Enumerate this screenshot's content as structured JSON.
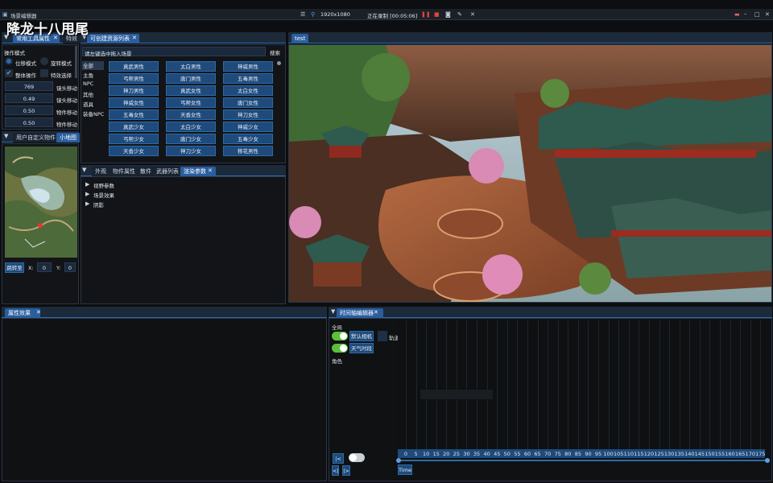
{
  "titlebar": {
    "app_title": "场景编辑器",
    "resolution": "1920x1080",
    "recording_status": "正在录制 [00:05:06]",
    "window_buttons": [
      "minimize",
      "maximize",
      "close"
    ]
  },
  "overlay_title": "降龙十八甩尾",
  "tool_panel": {
    "tabs": [
      {
        "label": "常用工具属性",
        "active": true
      },
      {
        "label": "特效",
        "active": false
      }
    ],
    "section_label": "操作模式",
    "radio_move": "位移模式",
    "radio_rotate": "旋转模式",
    "check_whole": "整体操作",
    "check_effect": "特效选择",
    "rows": [
      {
        "value": "769",
        "label": "镜头移动"
      },
      {
        "value": "0.49",
        "label": "镜头移动"
      },
      {
        "value": "0.50",
        "label": "物件移动"
      },
      {
        "value": "0.50",
        "label": "物件移动"
      }
    ]
  },
  "map_panel": {
    "tabs": [
      {
        "label": "用户自定义物件",
        "active": false
      },
      {
        "label": "小地图",
        "active": true
      }
    ],
    "jump_button": "跳转至",
    "x_label": "X:",
    "x_value": "0",
    "y_label": "Y:",
    "y_value": "0"
  },
  "resource_panel": {
    "tab": "可创建资源列表",
    "search_placeholder": "请左键选中拖入场景",
    "search_button": "搜索",
    "categories": [
      "全部",
      "主角",
      "NPC",
      "其他",
      "道具",
      "装备NPC"
    ],
    "grid": [
      [
        "真武男性",
        "太白男性",
        "神威男性"
      ],
      [
        "丐帮男性",
        "唐门男性",
        "五毒男性"
      ],
      [
        "神刀男性",
        "真武女性",
        "太白女性"
      ],
      [
        "神威女性",
        "丐帮女性",
        "唐门女性"
      ],
      [
        "五毒女性",
        "天香女性",
        "神刀女性"
      ],
      [
        "真武少女",
        "太白少女",
        "神威少女"
      ],
      [
        "丐帮少女",
        "唐门少女",
        "五毒少女"
      ],
      [
        "天香少女",
        "神刀少女",
        "移花男性"
      ]
    ]
  },
  "props_panel": {
    "tabs": [
      {
        "label": "外观",
        "active": false
      },
      {
        "label": "物件属性",
        "active": false
      },
      {
        "label": "散件",
        "active": false
      },
      {
        "label": "武器列表",
        "active": false
      },
      {
        "label": "渲染参数",
        "active": true
      }
    ],
    "tree": [
      "视野参数",
      "场景效果",
      "阴影"
    ]
  },
  "viewport": {
    "tab": "test"
  },
  "effects_panel": {
    "tab": "属性效果"
  },
  "timeline": {
    "tab": "时间轴编辑器",
    "group_all": "全局",
    "tracks": [
      {
        "label": "默认相机",
        "enabled": true,
        "extra": "轨道"
      },
      {
        "label": "天气时段",
        "enabled": true
      }
    ],
    "group_role": "角色",
    "axis_ticks": [
      "0",
      "5",
      "10",
      "15",
      "20",
      "25",
      "30",
      "35",
      "40",
      "45",
      "50",
      "55",
      "60",
      "65",
      "70",
      "75",
      "80",
      "85",
      "90",
      "95",
      "100",
      "105",
      "110",
      "115",
      "120",
      "125",
      "130",
      "135",
      "140",
      "145",
      "150",
      "155",
      "160",
      "165",
      "170",
      "175"
    ],
    "axis_label": "Time",
    "nav_buttons": [
      "|<",
      "<|",
      "|>"
    ]
  },
  "colors": {
    "accent": "#2a5e9e",
    "toggle_on": "#5bbf3a",
    "panel_bg": "#121417"
  }
}
